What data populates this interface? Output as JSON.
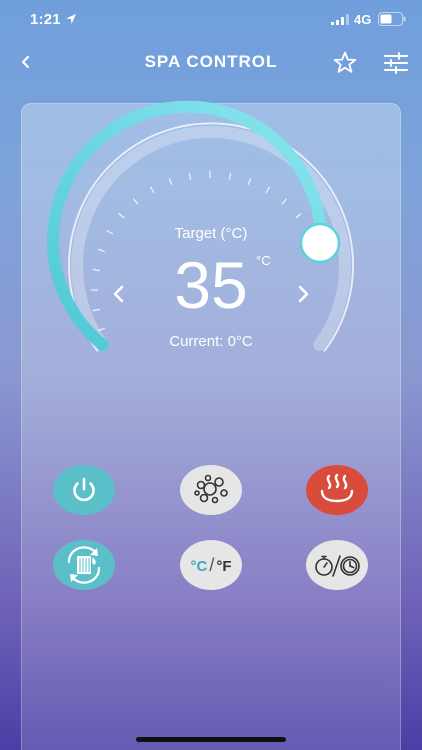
{
  "status_bar": {
    "time": "1:21",
    "network": "4G"
  },
  "nav": {
    "title": "SPA CONTROL"
  },
  "thermostat": {
    "target_label": "Target (°C)",
    "target_value": "35",
    "unit": "°C",
    "current_label": "Current: 0°C"
  },
  "controls": [
    {
      "name": "power",
      "icon": "power-icon",
      "color": "#5bbfc9"
    },
    {
      "name": "bubbles",
      "icon": "bubbles-icon",
      "color": "#e6e6e6"
    },
    {
      "name": "heater",
      "icon": "heat-icon",
      "color": "#d94b3b"
    },
    {
      "name": "filter",
      "icon": "filter-cycle-icon",
      "color": "#5bbfc9"
    },
    {
      "name": "unit-toggle",
      "icon": "celsius-fahrenheit-icon",
      "label_c": "°C",
      "label_sep": "/",
      "label_f": "°F",
      "color": "#e6e6e6"
    },
    {
      "name": "timer",
      "icon": "timer-icon",
      "color": "#e6e6e6"
    }
  ],
  "colors": {
    "accent": "#5fd1dc",
    "heater": "#d94b3b",
    "inactive": "#e6e6e6"
  }
}
